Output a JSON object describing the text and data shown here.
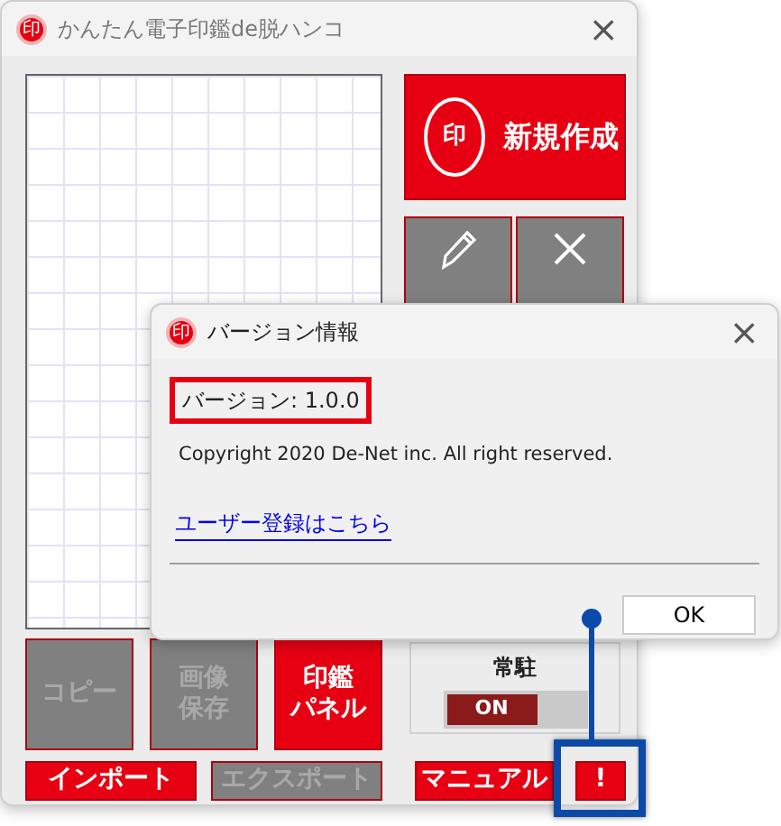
{
  "main_window": {
    "title": "かんたん電子印鑑de脱ハンコ",
    "app_icon": "印",
    "close": "×",
    "new_button": {
      "icon_text": "印",
      "label": "新規作成"
    },
    "tool_buttons": [
      {
        "kind": "edit",
        "disabled": true
      },
      {
        "kind": "delete",
        "disabled": true
      }
    ],
    "action_buttons": [
      {
        "lines": [
          "コピー"
        ],
        "disabled": true
      },
      {
        "lines": [
          "画像",
          "保存"
        ],
        "disabled": true
      },
      {
        "lines": [
          "印鑑",
          "パネル"
        ],
        "disabled": false
      }
    ],
    "resident": {
      "label": "常駐",
      "toggle_text": "ON",
      "on": true
    },
    "bottom_buttons": [
      {
        "label": "インポート",
        "disabled": false
      },
      {
        "label": "エクスポート",
        "disabled": true
      },
      {
        "label": "マニュアル",
        "disabled": false
      },
      {
        "label": "!",
        "disabled": false,
        "highlighted": true
      }
    ]
  },
  "dialog": {
    "title": "バージョン情報",
    "app_icon": "印",
    "close": "×",
    "version": "バージョン: 1.0.0",
    "copyright": "Copyright 2020 De-Net inc. All right reserved.",
    "link": "ユーザー登録はこちら",
    "ok_button": "OK"
  }
}
